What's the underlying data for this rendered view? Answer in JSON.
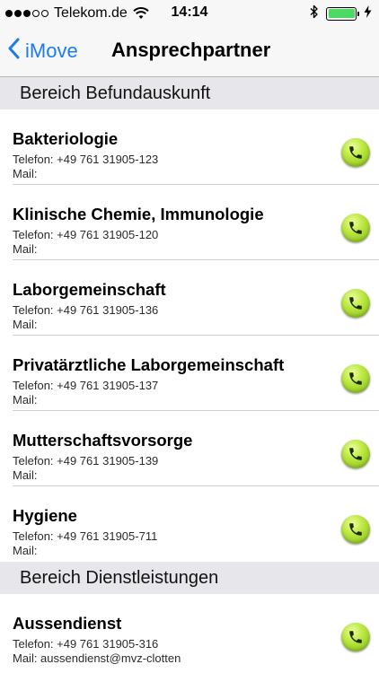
{
  "status_bar": {
    "carrier": "Telekom.de",
    "time": "14:14",
    "battery_color": "#4cd964",
    "icons": [
      "signal-dots-icon",
      "wifi-icon",
      "bluetooth-icon",
      "battery-icon",
      "charging-bolt-icon"
    ]
  },
  "nav": {
    "back_label": "iMove",
    "back_icon": "chevron-left-icon",
    "title": "Ansprechpartner",
    "accent_color": "#1a7cf0"
  },
  "sections": [
    {
      "header": "Bereich Befundauskunft",
      "items": [
        {
          "title": "Bakteriologie",
          "phone": "Telefon: +49 761 31905-123",
          "mail": "Mail:"
        },
        {
          "title": "Klinische Chemie, Immunologie",
          "phone": "Telefon: +49 761 31905-120",
          "mail": "Mail:"
        },
        {
          "title": "Laborgemeinschaft",
          "phone": "Telefon: +49 761 31905-136",
          "mail": "Mail:"
        },
        {
          "title": "Privatärztliche Laborgemeinschaft",
          "phone": "Telefon: +49 761 31905-137",
          "mail": "Mail:"
        },
        {
          "title": "Mutterschaftsvorsorge",
          "phone": "Telefon: +49 761 31905-139",
          "mail": "Mail:"
        },
        {
          "title": "Hygiene",
          "phone": "Telefon: +49 761 31905-711",
          "mail": "Mail:"
        }
      ]
    },
    {
      "header": "Bereich Dienstleistungen",
      "items": [
        {
          "title": "Aussendienst",
          "phone": "Telefon: +49 761 31905-316",
          "mail": "Mail: aussendienst@mvz-clotten"
        }
      ]
    }
  ],
  "call_icon": "phone-call-icon"
}
